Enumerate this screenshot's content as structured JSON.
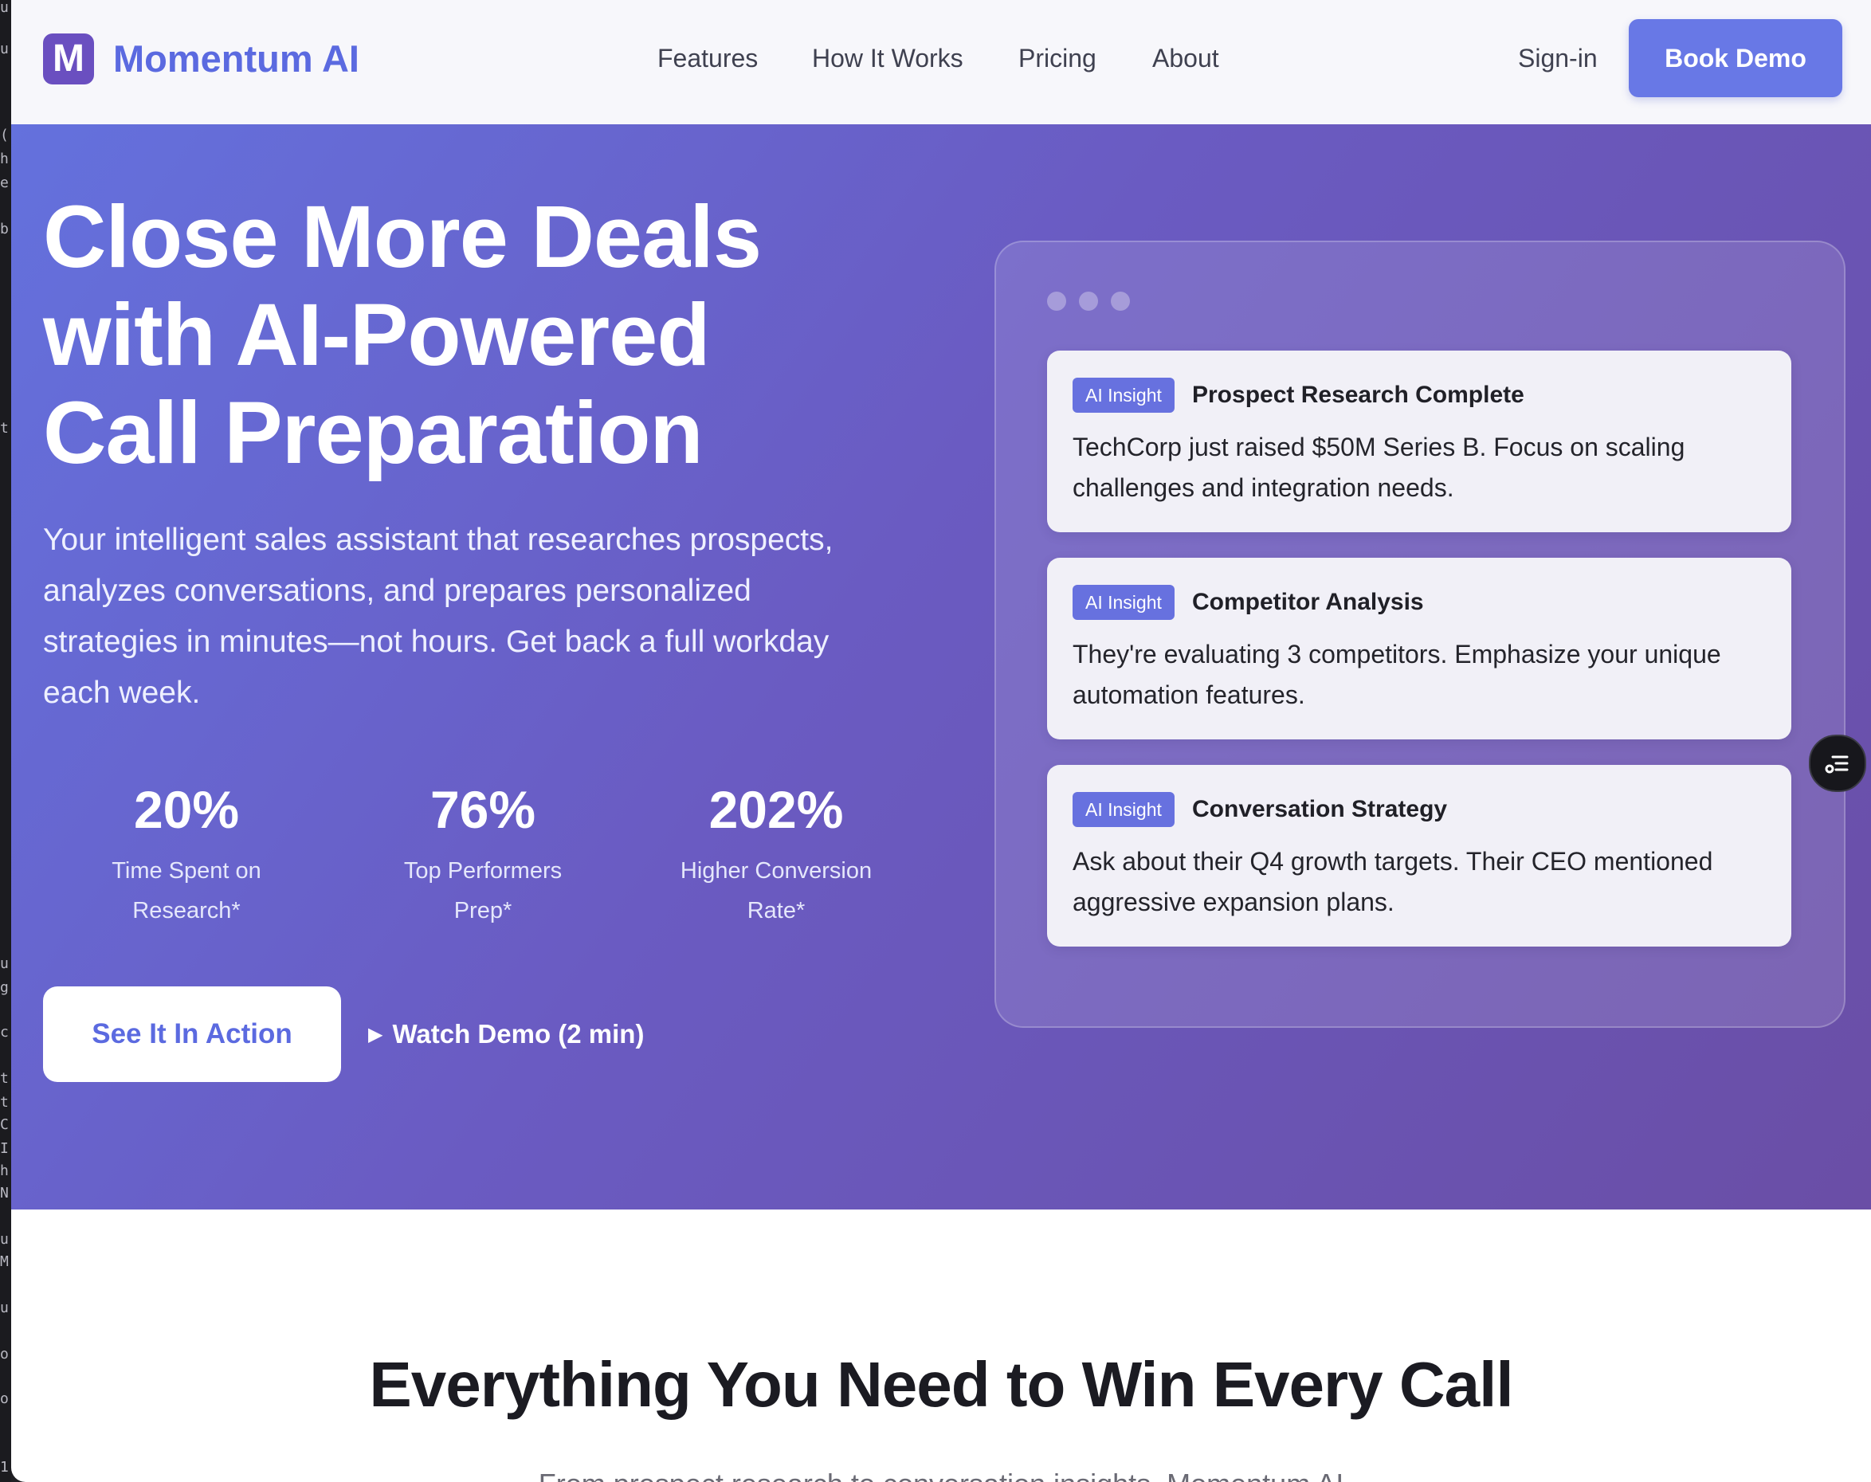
{
  "brand": {
    "logo_letter": "M",
    "name": "Momentum AI",
    "accent_color": "#6878e6",
    "logo_color": "#6a4fc0"
  },
  "nav": {
    "links": [
      "Features",
      "How It Works",
      "Pricing",
      "About"
    ],
    "signin_label": "Sign-in",
    "book_demo_label": "Book Demo"
  },
  "hero": {
    "title_lines": [
      "Close More Deals",
      "with AI-Powered",
      "Call Preparation"
    ],
    "subtitle": "Your intelligent sales assistant that researches prospects, analyzes conversations, and prepares personalized strategies in minutes—not hours. Get back a full workday each week.",
    "stats": [
      {
        "value": "20%",
        "label_lines": [
          "Time Spent on",
          "Research*"
        ]
      },
      {
        "value": "76%",
        "label_lines": [
          "Top Performers",
          "Prep*"
        ]
      },
      {
        "value": "202%",
        "label_lines": [
          "Higher Conversion",
          "Rate*"
        ]
      }
    ],
    "primary_cta": "See It In Action",
    "secondary_cta": "Watch Demo (2 min)",
    "secondary_cta_icon": "play-icon"
  },
  "insight_panel": {
    "cards": [
      {
        "badge": "AI Insight",
        "title": "Prospect Research Complete",
        "body": "TechCorp just raised $50M Series B. Focus on scaling challenges and integration needs."
      },
      {
        "badge": "AI Insight",
        "title": "Competitor Analysis",
        "body": "They're evaluating 3 competitors. Emphasize your unique automation features."
      },
      {
        "badge": "AI Insight",
        "title": "Conversation Strategy",
        "body": "Ask about their Q4 growth targets. Their CEO mentioned aggressive expansion plans."
      }
    ]
  },
  "floating_button": {
    "icon": "list-menu-icon"
  },
  "features": {
    "title": "Everything You Need to Win Every Call",
    "subtitle_partial": "From prospect research to conversation insights, Momentum AI"
  },
  "background_terminal_chars": [
    "u",
    "u",
    "(",
    "h",
    "e",
    "b",
    "t",
    "u",
    "g",
    "c",
    "t",
    "t",
    "C",
    "I",
    "h",
    "N",
    "u",
    "M",
    "u",
    "o",
    "o",
    "1"
  ]
}
